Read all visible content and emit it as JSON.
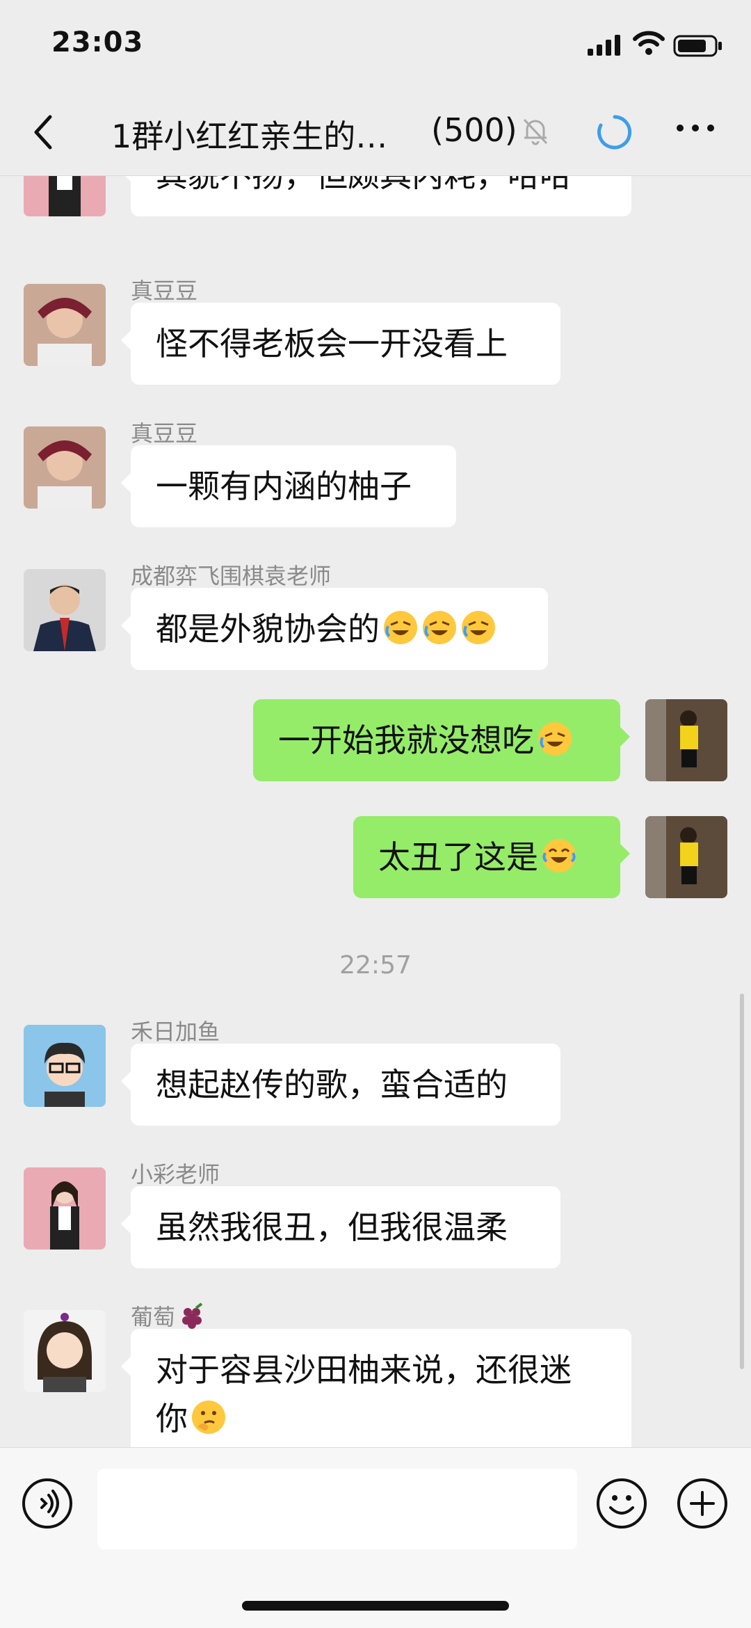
{
  "status_bar": {
    "time": "23:03"
  },
  "nav": {
    "title": "1群小红红亲生的…",
    "member_count": "(500)"
  },
  "messages": [
    {
      "sender": "",
      "text": "其貌不扬，但颇具内耗，哈哈",
      "side": "left"
    },
    {
      "sender": "真豆豆",
      "text": "怪不得老板会一开没看上",
      "side": "left"
    },
    {
      "sender": "真豆豆",
      "text": "一颗有内涵的柚子",
      "side": "left"
    },
    {
      "sender": "成都弈飞围棋袁老师",
      "text": "都是外貌协会的",
      "side": "left",
      "emoji": "crying-laughing-emoji x3"
    },
    {
      "text": "一开始我就没想吃",
      "side": "right",
      "emoji": "crying-laughing-emoji"
    },
    {
      "text": "太丑了这是",
      "side": "right",
      "emoji": "tears-of-joy-emoji"
    },
    {
      "sender": "禾日加鱼",
      "text": "想起赵传的歌，蛮合适的",
      "side": "left"
    },
    {
      "sender": "小彩老师",
      "text": "虽然我很丑，但我很温柔",
      "side": "left"
    },
    {
      "sender": "葡萄",
      "sender_emoji": "grapes-emoji",
      "text_line1": "对于容县沙田柚来说，还很迷",
      "text_line2": "你",
      "side": "left",
      "emoji": "thinking-face-emoji"
    }
  ],
  "time_separator": "22:57",
  "colors": {
    "background": "#ededed",
    "bubble_self": "#95ec69",
    "bubble_other": "#ffffff",
    "accent_loading": "#3d9ee8"
  }
}
